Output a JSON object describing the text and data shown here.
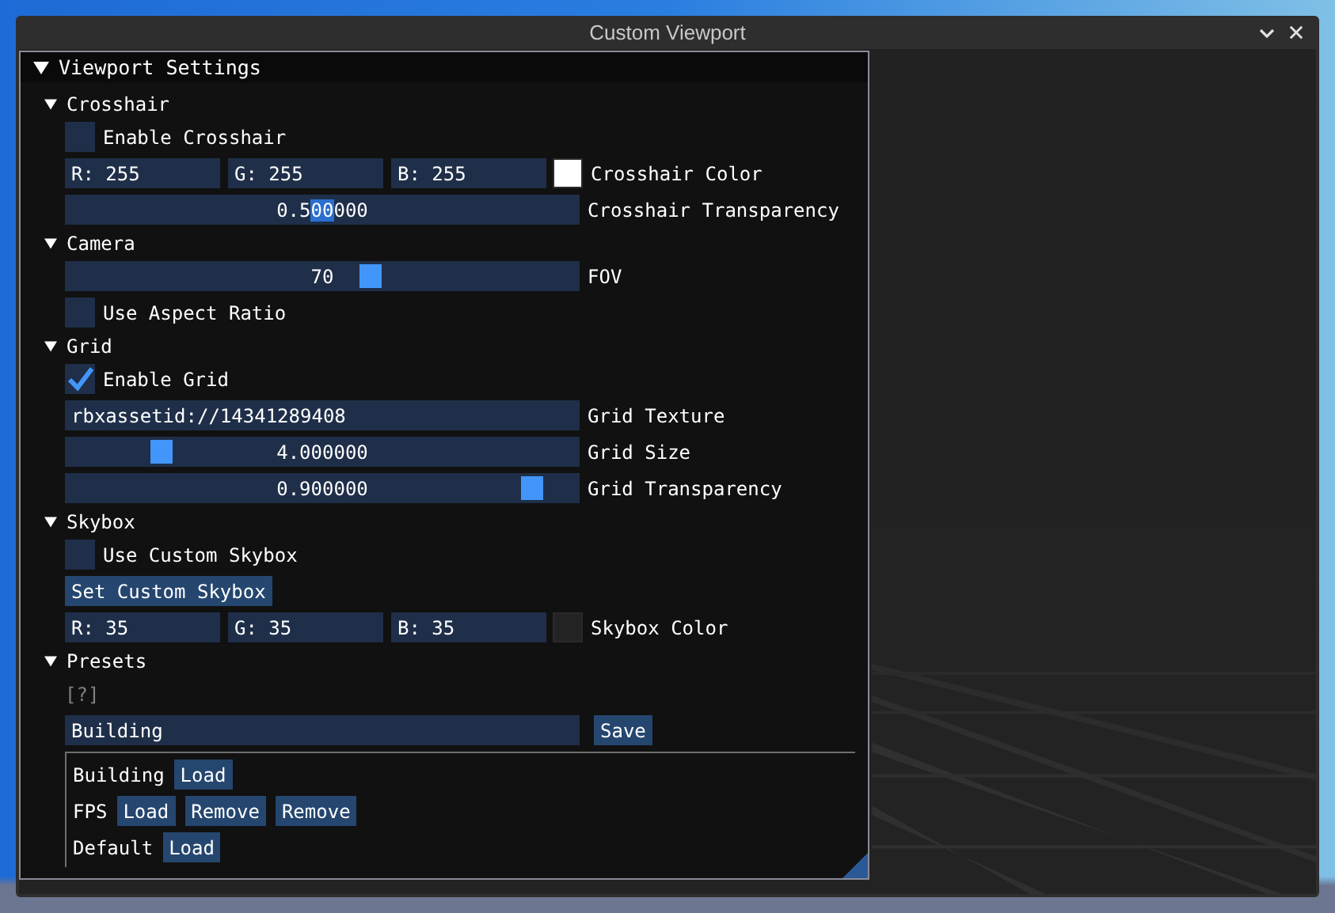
{
  "window": {
    "title": "Custom Viewport"
  },
  "settings_panel": {
    "title": "Viewport Settings",
    "expanded": true,
    "sections": [
      {
        "title": "Crosshair",
        "expanded": true,
        "items": [
          {
            "kind": "checkbox",
            "label": "Enable Crosshair",
            "checked": false
          },
          {
            "kind": "color",
            "fields": [
              "R: 255",
              "G: 255",
              "B: 255"
            ],
            "color": "#ffffff",
            "label": "Crosshair Color"
          },
          {
            "kind": "drag_edit",
            "value_parts": [
              {
                "text": "0.5",
                "selected": false
              },
              {
                "text": "00",
                "selected": true
              },
              {
                "text": "000",
                "selected": false
              }
            ],
            "label": "Crosshair Transparency"
          }
        ]
      },
      {
        "title": "Camera",
        "expanded": true,
        "items": [
          {
            "kind": "slider",
            "value": "70",
            "level": 0.6,
            "label": "FOV"
          },
          {
            "kind": "checkbox",
            "label": "Use Aspect Ratio",
            "checked": false
          }
        ]
      },
      {
        "title": "Grid",
        "expanded": true,
        "items": [
          {
            "kind": "checkbox",
            "label": "Enable Grid",
            "checked": true
          },
          {
            "kind": "text_input",
            "text": "rbxassetid://14341289408",
            "label": "Grid Texture"
          },
          {
            "kind": "slider",
            "value": "4.000000",
            "level": 0.17,
            "label": "Grid Size"
          },
          {
            "kind": "slider",
            "value": "0.900000",
            "level": 0.93,
            "label": "Grid Transparency"
          }
        ]
      },
      {
        "title": "Skybox",
        "expanded": true,
        "items": [
          {
            "kind": "checkbox",
            "label": "Use Custom Skybox",
            "checked": false
          },
          {
            "kind": "button",
            "label": "Set Custom Skybox"
          },
          {
            "kind": "color",
            "fields": [
              "R: 35",
              "G: 35",
              "B: 35"
            ],
            "color": "#232323",
            "label": "Skybox Color"
          }
        ]
      },
      {
        "title": "Presets",
        "expanded": true,
        "items": [
          {
            "kind": "help",
            "text": "[?]"
          },
          {
            "kind": "input_button",
            "value": "Building",
            "button": "Save"
          },
          {
            "kind": "preset_list",
            "rows": [
              {
                "name": "Building",
                "buttons": [
                  "Load"
                ]
              },
              {
                "name": "FPS",
                "buttons": [
                  "Load",
                  "Remove",
                  "Remove"
                ]
              },
              {
                "name": "Default",
                "buttons": [
                  "Load"
                ]
              }
            ]
          }
        ]
      }
    ]
  }
}
